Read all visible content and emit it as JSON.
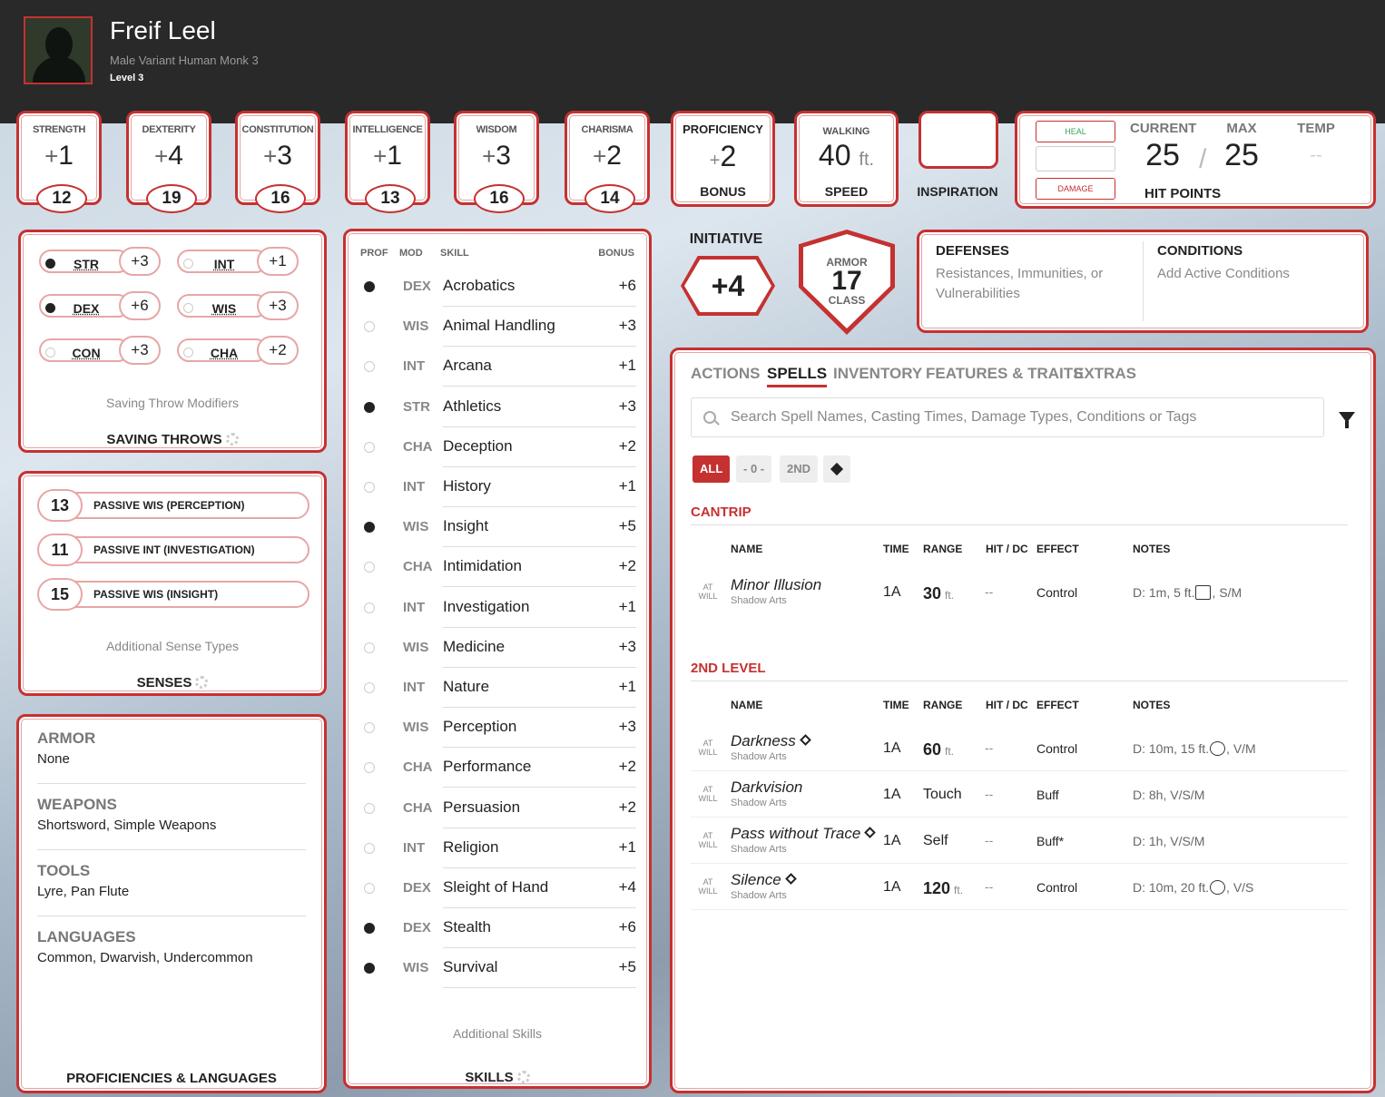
{
  "character": {
    "name": "Freif Leel",
    "subtitle": "Male  Variant Human  Monk 3",
    "level": "Level 3"
  },
  "abilities": [
    {
      "label": "STRENGTH",
      "sign": "+",
      "mod": "1",
      "score": "12"
    },
    {
      "label": "DEXTERITY",
      "sign": "+",
      "mod": "4",
      "score": "19"
    },
    {
      "label": "CONSTITUTION",
      "sign": "+",
      "mod": "3",
      "score": "16"
    },
    {
      "label": "INTELLIGENCE",
      "sign": "+",
      "mod": "1",
      "score": "13"
    },
    {
      "label": "WISDOM",
      "sign": "+",
      "mod": "3",
      "score": "16"
    },
    {
      "label": "CHARISMA",
      "sign": "+",
      "mod": "2",
      "score": "14"
    }
  ],
  "proficiency": {
    "top": "PROFICIENCY",
    "sign": "+",
    "value": "2",
    "bottom": "BONUS"
  },
  "speed": {
    "top": "WALKING",
    "value": "40",
    "unit": "ft.",
    "bottom": "SPEED"
  },
  "inspiration": {
    "label": "INSPIRATION"
  },
  "hit_points": {
    "heal": "HEAL",
    "damage": "DAMAGE",
    "current_label": "CURRENT",
    "max_label": "MAX",
    "temp_label": "TEMP",
    "current": "25",
    "slash": "/",
    "max": "25",
    "temp": "--",
    "label": "HIT POINTS"
  },
  "saving_throws": {
    "title": "SAVING THROWS",
    "note": "Saving Throw Modifiers",
    "items": [
      {
        "abbr": "STR",
        "value": "+3",
        "proficient": true
      },
      {
        "abbr": "INT",
        "value": "+1",
        "proficient": false
      },
      {
        "abbr": "DEX",
        "value": "+6",
        "proficient": true
      },
      {
        "abbr": "WIS",
        "value": "+3",
        "proficient": false
      },
      {
        "abbr": "CON",
        "value": "+3",
        "proficient": false
      },
      {
        "abbr": "CHA",
        "value": "+2",
        "proficient": false
      }
    ]
  },
  "senses": {
    "title": "SENSES",
    "note": "Additional Sense Types",
    "items": [
      {
        "value": "13",
        "label": "PASSIVE WIS (PERCEPTION)"
      },
      {
        "value": "11",
        "label": "PASSIVE INT (INVESTIGATION)"
      },
      {
        "value": "15",
        "label": "PASSIVE WIS (INSIGHT)"
      }
    ]
  },
  "proficiencies": {
    "title": "PROFICIENCIES & LANGUAGES",
    "sections": [
      {
        "heading": "ARMOR",
        "text": "None"
      },
      {
        "heading": "WEAPONS",
        "text": "Shortsword, Simple Weapons"
      },
      {
        "heading": "TOOLS",
        "text": "Lyre, Pan Flute"
      },
      {
        "heading": "LANGUAGES",
        "text": "Common, Dwarvish, Undercommon"
      }
    ]
  },
  "skills": {
    "title": "SKILLS",
    "note": "Additional Skills",
    "headers": {
      "prof": "PROF",
      "mod": "MOD",
      "skill": "SKILL",
      "bonus": "BONUS"
    },
    "items": [
      {
        "mod": "DEX",
        "name": "Acrobatics",
        "bonus": "+6",
        "proficient": true
      },
      {
        "mod": "WIS",
        "name": "Animal Handling",
        "bonus": "+3",
        "proficient": false
      },
      {
        "mod": "INT",
        "name": "Arcana",
        "bonus": "+1",
        "proficient": false
      },
      {
        "mod": "STR",
        "name": "Athletics",
        "bonus": "+3",
        "proficient": true
      },
      {
        "mod": "CHA",
        "name": "Deception",
        "bonus": "+2",
        "proficient": false
      },
      {
        "mod": "INT",
        "name": "History",
        "bonus": "+1",
        "proficient": false
      },
      {
        "mod": "WIS",
        "name": "Insight",
        "bonus": "+5",
        "proficient": true
      },
      {
        "mod": "CHA",
        "name": "Intimidation",
        "bonus": "+2",
        "proficient": false
      },
      {
        "mod": "INT",
        "name": "Investigation",
        "bonus": "+1",
        "proficient": false
      },
      {
        "mod": "WIS",
        "name": "Medicine",
        "bonus": "+3",
        "proficient": false
      },
      {
        "mod": "INT",
        "name": "Nature",
        "bonus": "+1",
        "proficient": false
      },
      {
        "mod": "WIS",
        "name": "Perception",
        "bonus": "+3",
        "proficient": false
      },
      {
        "mod": "CHA",
        "name": "Performance",
        "bonus": "+2",
        "proficient": false
      },
      {
        "mod": "CHA",
        "name": "Persuasion",
        "bonus": "+2",
        "proficient": false
      },
      {
        "mod": "INT",
        "name": "Religion",
        "bonus": "+1",
        "proficient": false
      },
      {
        "mod": "DEX",
        "name": "Sleight of Hand",
        "bonus": "+4",
        "proficient": false
      },
      {
        "mod": "DEX",
        "name": "Stealth",
        "bonus": "+6",
        "proficient": true
      },
      {
        "mod": "WIS",
        "name": "Survival",
        "bonus": "+5",
        "proficient": true
      }
    ]
  },
  "initiative": {
    "label": "INITIATIVE",
    "value": "+4"
  },
  "armor_class": {
    "top": "ARMOR",
    "value": "17",
    "bottom": "CLASS"
  },
  "defenses": {
    "title": "DEFENSES",
    "text": "Resistances, Immunities, or Vulnerabilities",
    "conditions_title": "CONDITIONS",
    "conditions_text": "Add Active Conditions"
  },
  "tabs": [
    "ACTIONS",
    "SPELLS",
    "INVENTORY",
    "FEATURES & TRAITS",
    "EXTRAS"
  ],
  "active_tab": "SPELLS",
  "search": {
    "placeholder": "Search Spell Names, Casting Times, Damage Types, Conditions or Tags"
  },
  "filters": {
    "all": "ALL",
    "cantrip": "- 0 -",
    "second": "2ND"
  },
  "spell_columns": {
    "name": "NAME",
    "time": "TIME",
    "range": "RANGE",
    "hit": "HIT / DC",
    "effect": "EFFECT",
    "notes": "NOTES"
  },
  "spell_sections": [
    {
      "title": "CANTRIP",
      "spells": [
        {
          "at": "AT",
          "will": "WILL",
          "name": "Minor Illusion",
          "conc": false,
          "source": "Shadow Arts",
          "time": "1A",
          "range": "30",
          "range_unit": "ft.",
          "hit": "--",
          "effect": "Control",
          "notes_pre": "D: 1m, 5 ft.",
          "shape": "cube",
          "notes_post": ", S/M"
        }
      ]
    },
    {
      "title": "2ND LEVEL",
      "spells": [
        {
          "at": "AT",
          "will": "WILL",
          "name": "Darkness",
          "conc": true,
          "source": "Shadow Arts",
          "time": "1A",
          "range": "60",
          "range_unit": "ft.",
          "hit": "--",
          "effect": "Control",
          "notes_pre": "D: 10m, 15 ft.",
          "shape": "sphere",
          "notes_post": ", V/M"
        },
        {
          "at": "AT",
          "will": "WILL",
          "name": "Darkvision",
          "conc": false,
          "source": "Shadow Arts",
          "time": "1A",
          "range": "Touch",
          "range_unit": "",
          "hit": "--",
          "effect": "Buff",
          "notes_pre": "D: 8h, V/S/M",
          "shape": "",
          "notes_post": ""
        },
        {
          "at": "AT",
          "will": "WILL",
          "name": "Pass without Trace",
          "conc": true,
          "source": "Shadow Arts",
          "time": "1A",
          "range": "Self",
          "range_unit": "",
          "hit": "--",
          "effect": "Buff*",
          "notes_pre": "D: 1h, V/S/M",
          "shape": "",
          "notes_post": ""
        },
        {
          "at": "AT",
          "will": "WILL",
          "name": "Silence",
          "conc": true,
          "source": "Shadow Arts",
          "time": "1A",
          "range": "120",
          "range_unit": "ft.",
          "hit": "--",
          "effect": "Control",
          "notes_pre": "D: 10m, 20 ft.",
          "shape": "sphere",
          "notes_post": ", V/S"
        }
      ]
    }
  ],
  "colors": {
    "accent": "#c53131",
    "header": "#292929",
    "heal": "#3aa35a"
  }
}
